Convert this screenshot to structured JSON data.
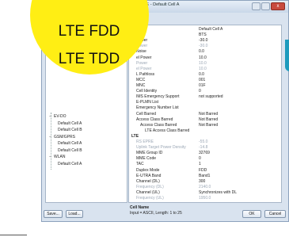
{
  "dialog": {
    "title": "mer: LTE - Default Cell A",
    "close_glyph": "x"
  },
  "overlay": {
    "line1": "LTE FDD",
    "line2": "LTE TDD",
    "color": "#ffee14"
  },
  "tree": {
    "items": [
      {
        "label": "EV-DO",
        "group": true
      },
      {
        "label": "Default Cell A",
        "group": false
      },
      {
        "label": "Default Cell B",
        "group": false
      },
      {
        "label": "GSM/GPRS",
        "group": true
      },
      {
        "label": "Default Cell A",
        "group": false
      },
      {
        "label": "Default Cell B",
        "group": false
      },
      {
        "label": "WLAN",
        "group": true
      },
      {
        "label": "Default Cell A",
        "group": false
      }
    ]
  },
  "grid": {
    "rows": [
      {
        "key": "me",
        "value": "Default Cell A",
        "style": ""
      },
      {
        "key": "Point",
        "value": "BTS",
        "style": ""
      },
      {
        "key": "Power",
        "value": "-30.0",
        "style": ""
      },
      {
        "key": "Power",
        "value": "-30.0",
        "style": "dis"
      },
      {
        "key": "Noise",
        "value": "0.0",
        "style": ""
      },
      {
        "key": "el Power",
        "value": "10.0",
        "style": ""
      },
      {
        "key": "Power",
        "value": "10.0",
        "style": "dis"
      },
      {
        "key": "el Power",
        "value": "10.0",
        "style": "dis"
      },
      {
        "key": "L Pathloss",
        "value": "0.0",
        "style": ""
      },
      {
        "key": "MCC",
        "value": "001",
        "style": ""
      },
      {
        "key": "MNC",
        "value": "01F",
        "style": ""
      },
      {
        "key": "Cell Identity",
        "value": "0",
        "style": ""
      },
      {
        "key": "IMS Emergency Support",
        "value": "not supported",
        "style": ""
      },
      {
        "key": "E-PLMN List",
        "value": "",
        "style": ""
      },
      {
        "key": "Emergency Number List",
        "value": "",
        "style": ""
      },
      {
        "key": "Cell Barred",
        "value": "Not Barred",
        "style": ""
      },
      {
        "key": "Access Class Barred",
        "value": "Not Barred",
        "style": ""
      },
      {
        "key": "Access Class Barred",
        "value": "Not Barred",
        "style": "sub"
      },
      {
        "key": "LTE Access Class Barred",
        "value": "",
        "style": "sub2"
      },
      {
        "key": "LTE",
        "value": "",
        "style": "sec"
      },
      {
        "key": "RS EPRE",
        "value": "-55.0",
        "style": "dis"
      },
      {
        "key": "Uplink Target Power Density",
        "value": "-14.8",
        "style": "dis"
      },
      {
        "key": "MME Group ID",
        "value": "32769",
        "style": ""
      },
      {
        "key": "MME Code",
        "value": "0",
        "style": ""
      },
      {
        "key": "TAC",
        "value": "1",
        "style": ""
      },
      {
        "key": "Duplex Mode",
        "value": "FDD",
        "style": ""
      },
      {
        "key": "E-UTRA Band",
        "value": "Band1",
        "style": ""
      },
      {
        "key": "Channel (DL)",
        "value": "300",
        "style": ""
      },
      {
        "key": "Frequency (DL)",
        "value": "2140.0",
        "style": "dis"
      },
      {
        "key": "Channel (UL)",
        "value": "Synchronizes with DL",
        "style": ""
      },
      {
        "key": "Frequency (UL)",
        "value": "1950.0",
        "style": "dis"
      }
    ]
  },
  "description": {
    "title": "Cell Name",
    "text": "Input = ASCII, Length: 1 to 25"
  },
  "buttons": {
    "save": "Save...",
    "load": "Load...",
    "ok": "OK",
    "cancel": "Cancel"
  }
}
